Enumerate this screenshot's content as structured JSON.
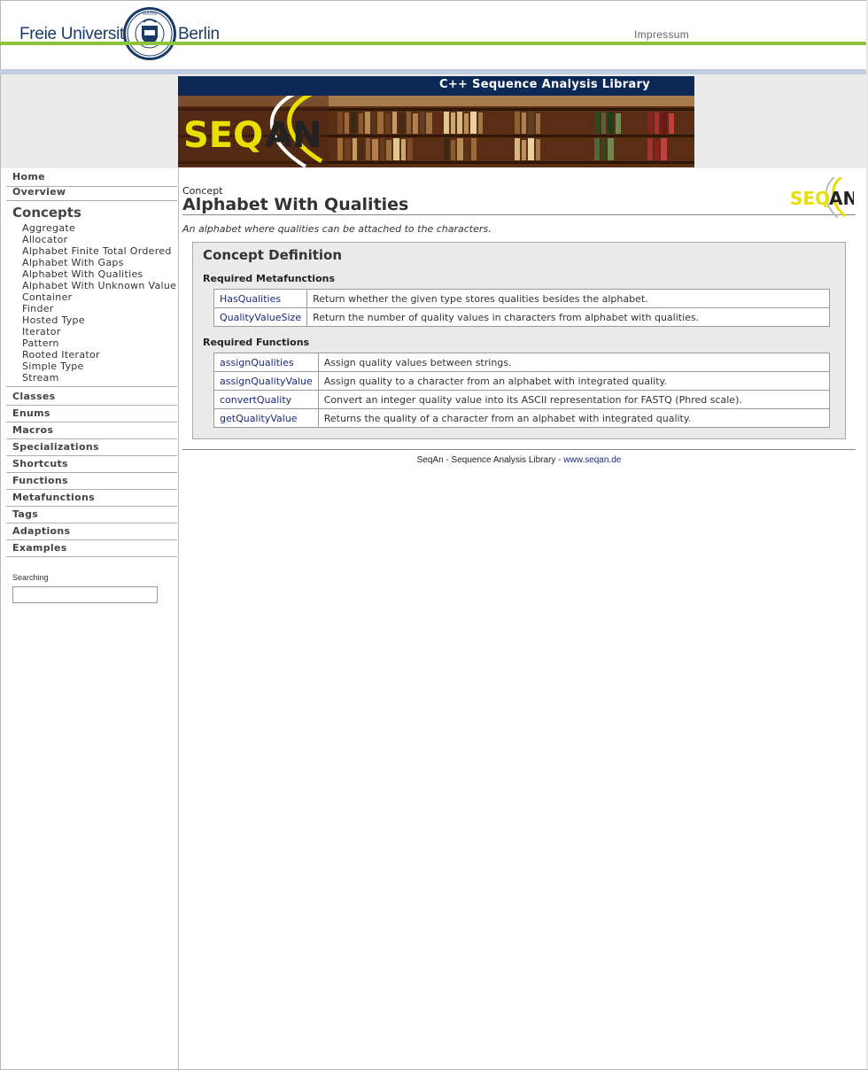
{
  "header": {
    "university_left": "Freie Universität",
    "university_right": "Berlin",
    "impressum": "Impressum"
  },
  "banner": {
    "title": "C++ Sequence Analysis Library",
    "logo_text": "SEQAN"
  },
  "sidebar": {
    "nav_top": [
      {
        "label": "Home"
      },
      {
        "label": "Overview"
      }
    ],
    "current_section": "Concepts",
    "concepts": [
      "Aggregate",
      "Allocator",
      "Alphabet Finite Total Ordered",
      "Alphabet With Gaps",
      "Alphabet With Qualities",
      "Alphabet With Unknown Value",
      "Container",
      "Finder",
      "Hosted Type",
      "Iterator",
      "Pattern",
      "Rooted Iterator",
      "Simple Type",
      "Stream"
    ],
    "nav_bottom": [
      "Classes",
      "Enums",
      "Macros",
      "Specializations",
      "Shortcuts",
      "Functions",
      "Metafunctions",
      "Tags",
      "Adaptions",
      "Examples"
    ],
    "search_label": "Searching",
    "search_value": ""
  },
  "main": {
    "kind": "Concept",
    "title": "Alphabet With Qualities",
    "summary": "An alphabet where qualities can be attached to the characters.",
    "logo_text": "SEQAN",
    "definition": {
      "title": "Concept Definition",
      "metafunctions_title": "Required Metafunctions",
      "metafunctions": [
        {
          "name": "HasQualities",
          "desc": "Return whether the given type stores qualities besides the alphabet."
        },
        {
          "name": "QualityValueSize",
          "desc": "Return the number of quality values in characters from alphabet with qualities."
        }
      ],
      "functions_title": "Required Functions",
      "functions": [
        {
          "name": "assignQualities",
          "desc": "Assign quality values between strings."
        },
        {
          "name": "assignQualityValue",
          "desc": "Assign quality to a character from an alphabet with integrated quality."
        },
        {
          "name": "convertQuality",
          "desc": "Convert an integer quality value into its ASCII representation for FASTQ (Phred scale)."
        },
        {
          "name": "getQualityValue",
          "desc": "Returns the quality of a character from an alphabet with integrated quality."
        }
      ]
    }
  },
  "footer": {
    "text": "SeqAn - Sequence Analysis Library - ",
    "link": "www.seqan.de"
  }
}
